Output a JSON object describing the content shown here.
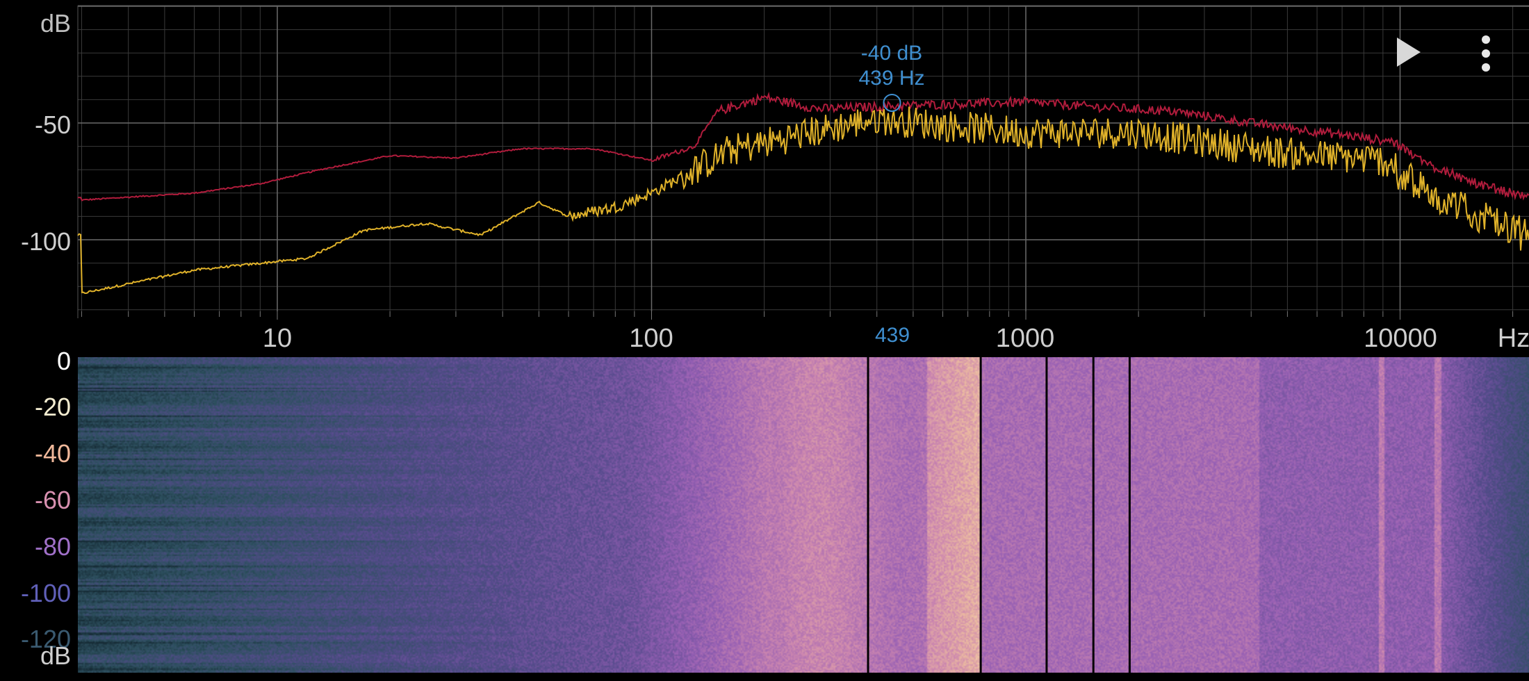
{
  "toolbar": {
    "play_icon": "play-icon",
    "menu_icon": "more-vert-icon"
  },
  "spectrum": {
    "y_unit": "dB",
    "x_unit": "Hz",
    "y_ticks": [
      "-50",
      "-100"
    ],
    "x_ticks": [
      "10",
      "100",
      "1000",
      "10000"
    ],
    "colors": {
      "grid": "#3a3a3a",
      "peak_line": "#b01c3c",
      "current_line": "#e0b22a",
      "cursor": "#3f8fd0",
      "tick_text": "#cfcfcf"
    }
  },
  "cursor": {
    "db_label": "-40 dB",
    "hz_label": "439 Hz",
    "axis_label": "439",
    "freq_hz": 439,
    "db_value": -40
  },
  "spectrogram": {
    "db_ticks": [
      "0",
      "-20",
      "-40",
      "-60",
      "-80",
      "-100",
      "-120"
    ],
    "db_tick_colors": [
      "#ffffff",
      "#f3ecd0",
      "#f0b89a",
      "#d890b0",
      "#a070c8",
      "#6060b8",
      "#3a5a70"
    ],
    "unit_label": "dB"
  }
}
